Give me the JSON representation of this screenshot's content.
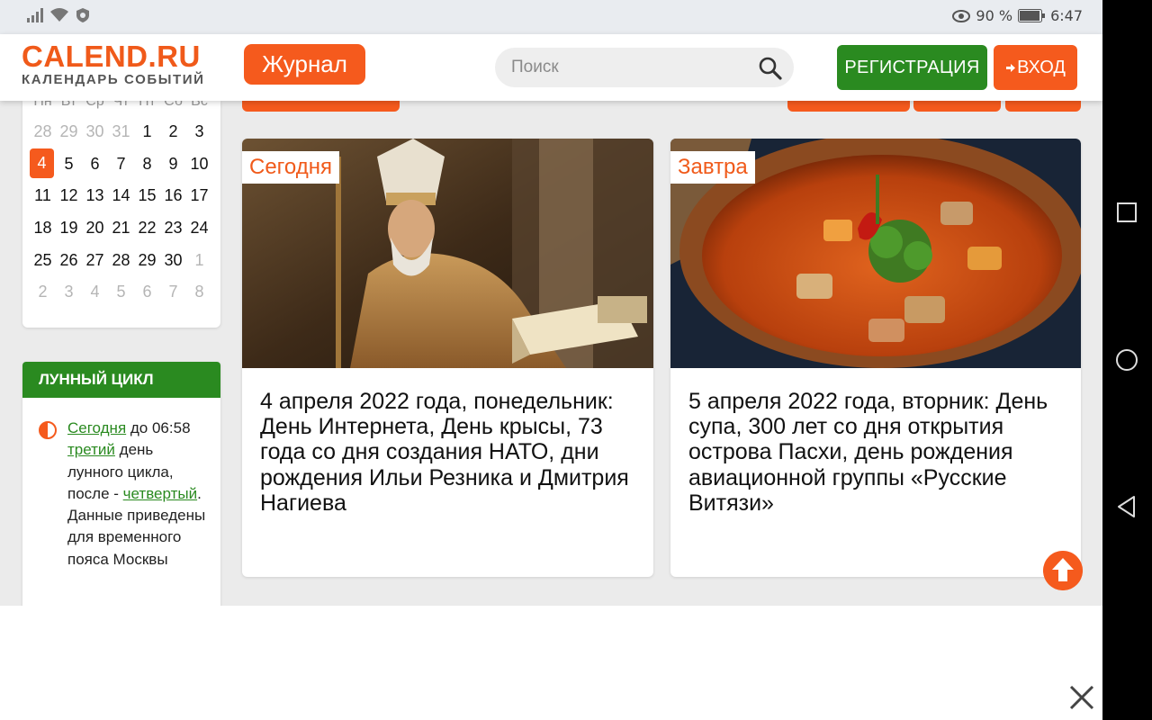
{
  "status_bar": {
    "battery": "90 %",
    "time": "6:47"
  },
  "header": {
    "logo_title": "CALEND.RU",
    "logo_subtitle": "КАЛЕНДАРЬ СОБЫТИЙ",
    "journal_label": "Журнал",
    "search_placeholder": "Поиск",
    "register_label": "РЕГИСТРАЦИЯ",
    "login_label": "ВХОД"
  },
  "calendar": {
    "weekday_headers": [
      "Пн",
      "Вт",
      "Ср",
      "Чт",
      "Пт",
      "Сб",
      "Вс"
    ],
    "days": [
      {
        "d": "28",
        "m": true
      },
      {
        "d": "29",
        "m": true
      },
      {
        "d": "30",
        "m": true
      },
      {
        "d": "31",
        "m": true
      },
      {
        "d": "1"
      },
      {
        "d": "2"
      },
      {
        "d": "3"
      },
      {
        "d": "4",
        "today": true
      },
      {
        "d": "5"
      },
      {
        "d": "6"
      },
      {
        "d": "7"
      },
      {
        "d": "8"
      },
      {
        "d": "9"
      },
      {
        "d": "10"
      },
      {
        "d": "11"
      },
      {
        "d": "12"
      },
      {
        "d": "13"
      },
      {
        "d": "14"
      },
      {
        "d": "15"
      },
      {
        "d": "16"
      },
      {
        "d": "17"
      },
      {
        "d": "18"
      },
      {
        "d": "19"
      },
      {
        "d": "20"
      },
      {
        "d": "21"
      },
      {
        "d": "22"
      },
      {
        "d": "23"
      },
      {
        "d": "24"
      },
      {
        "d": "25"
      },
      {
        "d": "26"
      },
      {
        "d": "27"
      },
      {
        "d": "28"
      },
      {
        "d": "29"
      },
      {
        "d": "30"
      },
      {
        "d": "1",
        "m": true
      },
      {
        "d": "2",
        "m": true
      },
      {
        "d": "3",
        "m": true
      },
      {
        "d": "4",
        "m": true
      },
      {
        "d": "5",
        "m": true
      },
      {
        "d": "6",
        "m": true
      },
      {
        "d": "7",
        "m": true
      },
      {
        "d": "8",
        "m": true
      }
    ]
  },
  "moon": {
    "title": "ЛУННЫЙ ЦИКЛ",
    "today_link": "Сегодня",
    "until_text": " до 06:58",
    "third_link": "третий",
    "after_third": " день лунного цикла, после - ",
    "fourth_link": "четвертый",
    "rest": ". Данные приведены для временного пояса Москвы"
  },
  "news": [
    {
      "tag": "Сегодня",
      "title": "4 апреля 2022 года, понедельник: День Интернета, День крысы, 73 года со дня создания НАТО, дни рождения Ильи Резника и Дмитрия Нагиева"
    },
    {
      "tag": "Завтра",
      "title": "5 апреля 2022 года, вторник: День супа, 300 лет со дня открытия острова Пасхи, день рождения авиационной группы «Русские Витязи»"
    }
  ],
  "colors": {
    "brand_orange": "#f55a1d",
    "brand_green": "#2a8a20"
  }
}
